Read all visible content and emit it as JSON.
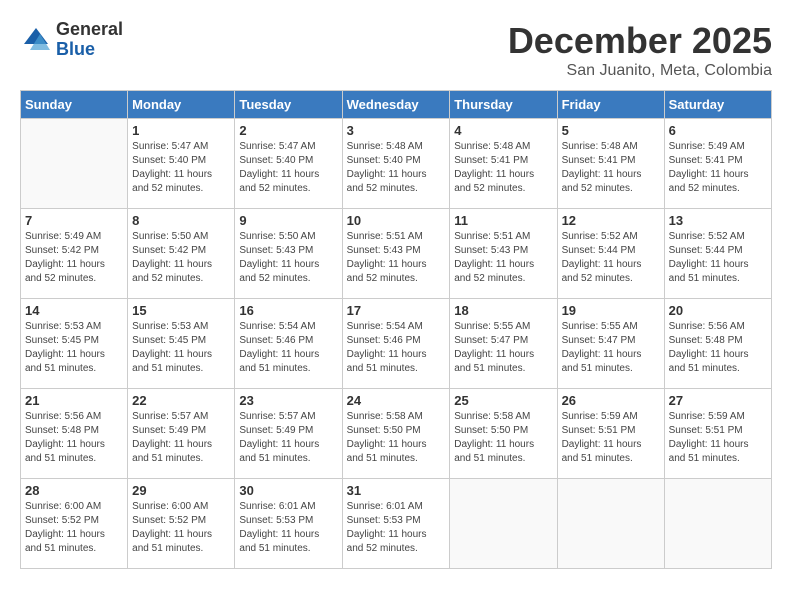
{
  "header": {
    "logo_general": "General",
    "logo_blue": "Blue",
    "month_title": "December 2025",
    "subtitle": "San Juanito, Meta, Colombia"
  },
  "calendar": {
    "days_of_week": [
      "Sunday",
      "Monday",
      "Tuesday",
      "Wednesday",
      "Thursday",
      "Friday",
      "Saturday"
    ],
    "weeks": [
      [
        {
          "day": "",
          "info": ""
        },
        {
          "day": "1",
          "info": "Sunrise: 5:47 AM\nSunset: 5:40 PM\nDaylight: 11 hours\nand 52 minutes."
        },
        {
          "day": "2",
          "info": "Sunrise: 5:47 AM\nSunset: 5:40 PM\nDaylight: 11 hours\nand 52 minutes."
        },
        {
          "day": "3",
          "info": "Sunrise: 5:48 AM\nSunset: 5:40 PM\nDaylight: 11 hours\nand 52 minutes."
        },
        {
          "day": "4",
          "info": "Sunrise: 5:48 AM\nSunset: 5:41 PM\nDaylight: 11 hours\nand 52 minutes."
        },
        {
          "day": "5",
          "info": "Sunrise: 5:48 AM\nSunset: 5:41 PM\nDaylight: 11 hours\nand 52 minutes."
        },
        {
          "day": "6",
          "info": "Sunrise: 5:49 AM\nSunset: 5:41 PM\nDaylight: 11 hours\nand 52 minutes."
        }
      ],
      [
        {
          "day": "7",
          "info": "Sunrise: 5:49 AM\nSunset: 5:42 PM\nDaylight: 11 hours\nand 52 minutes."
        },
        {
          "day": "8",
          "info": "Sunrise: 5:50 AM\nSunset: 5:42 PM\nDaylight: 11 hours\nand 52 minutes."
        },
        {
          "day": "9",
          "info": "Sunrise: 5:50 AM\nSunset: 5:43 PM\nDaylight: 11 hours\nand 52 minutes."
        },
        {
          "day": "10",
          "info": "Sunrise: 5:51 AM\nSunset: 5:43 PM\nDaylight: 11 hours\nand 52 minutes."
        },
        {
          "day": "11",
          "info": "Sunrise: 5:51 AM\nSunset: 5:43 PM\nDaylight: 11 hours\nand 52 minutes."
        },
        {
          "day": "12",
          "info": "Sunrise: 5:52 AM\nSunset: 5:44 PM\nDaylight: 11 hours\nand 52 minutes."
        },
        {
          "day": "13",
          "info": "Sunrise: 5:52 AM\nSunset: 5:44 PM\nDaylight: 11 hours\nand 51 minutes."
        }
      ],
      [
        {
          "day": "14",
          "info": "Sunrise: 5:53 AM\nSunset: 5:45 PM\nDaylight: 11 hours\nand 51 minutes."
        },
        {
          "day": "15",
          "info": "Sunrise: 5:53 AM\nSunset: 5:45 PM\nDaylight: 11 hours\nand 51 minutes."
        },
        {
          "day": "16",
          "info": "Sunrise: 5:54 AM\nSunset: 5:46 PM\nDaylight: 11 hours\nand 51 minutes."
        },
        {
          "day": "17",
          "info": "Sunrise: 5:54 AM\nSunset: 5:46 PM\nDaylight: 11 hours\nand 51 minutes."
        },
        {
          "day": "18",
          "info": "Sunrise: 5:55 AM\nSunset: 5:47 PM\nDaylight: 11 hours\nand 51 minutes."
        },
        {
          "day": "19",
          "info": "Sunrise: 5:55 AM\nSunset: 5:47 PM\nDaylight: 11 hours\nand 51 minutes."
        },
        {
          "day": "20",
          "info": "Sunrise: 5:56 AM\nSunset: 5:48 PM\nDaylight: 11 hours\nand 51 minutes."
        }
      ],
      [
        {
          "day": "21",
          "info": "Sunrise: 5:56 AM\nSunset: 5:48 PM\nDaylight: 11 hours\nand 51 minutes."
        },
        {
          "day": "22",
          "info": "Sunrise: 5:57 AM\nSunset: 5:49 PM\nDaylight: 11 hours\nand 51 minutes."
        },
        {
          "day": "23",
          "info": "Sunrise: 5:57 AM\nSunset: 5:49 PM\nDaylight: 11 hours\nand 51 minutes."
        },
        {
          "day": "24",
          "info": "Sunrise: 5:58 AM\nSunset: 5:50 PM\nDaylight: 11 hours\nand 51 minutes."
        },
        {
          "day": "25",
          "info": "Sunrise: 5:58 AM\nSunset: 5:50 PM\nDaylight: 11 hours\nand 51 minutes."
        },
        {
          "day": "26",
          "info": "Sunrise: 5:59 AM\nSunset: 5:51 PM\nDaylight: 11 hours\nand 51 minutes."
        },
        {
          "day": "27",
          "info": "Sunrise: 5:59 AM\nSunset: 5:51 PM\nDaylight: 11 hours\nand 51 minutes."
        }
      ],
      [
        {
          "day": "28",
          "info": "Sunrise: 6:00 AM\nSunset: 5:52 PM\nDaylight: 11 hours\nand 51 minutes."
        },
        {
          "day": "29",
          "info": "Sunrise: 6:00 AM\nSunset: 5:52 PM\nDaylight: 11 hours\nand 51 minutes."
        },
        {
          "day": "30",
          "info": "Sunrise: 6:01 AM\nSunset: 5:53 PM\nDaylight: 11 hours\nand 51 minutes."
        },
        {
          "day": "31",
          "info": "Sunrise: 6:01 AM\nSunset: 5:53 PM\nDaylight: 11 hours\nand 52 minutes."
        },
        {
          "day": "",
          "info": ""
        },
        {
          "day": "",
          "info": ""
        },
        {
          "day": "",
          "info": ""
        }
      ]
    ]
  }
}
